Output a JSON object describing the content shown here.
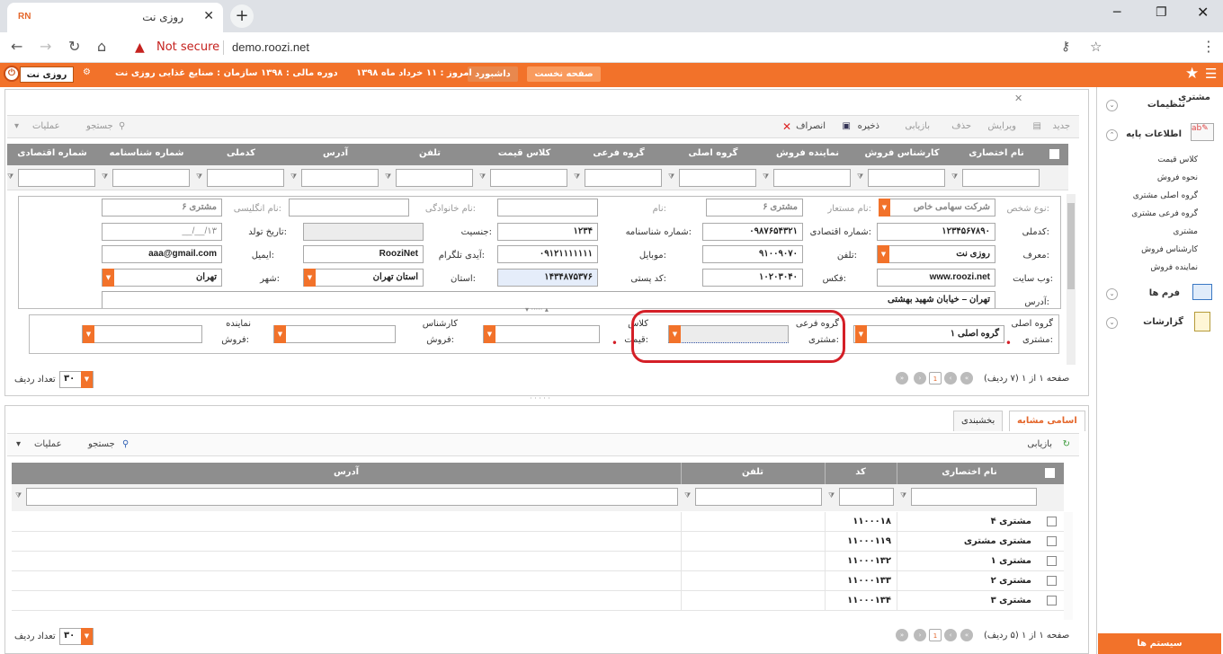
{
  "browser": {
    "tab_title": "روزی نت",
    "tab_icon_text": "RN",
    "new_tab": "+",
    "minimize": "─",
    "restore": "❐",
    "close": "✕",
    "not_secure": "Not secure",
    "url": "demo.roozi.net"
  },
  "topbar": {
    "home_btn": "صفحه نخست",
    "dashboard_btn": "داشبورد",
    "today": "امروز : ۱۱ خرداد ماه ۱۳۹۸",
    "fiscal": "دوره مالی : ۱۳۹۸",
    "org": "سازمان : صنایع غذایی روزی نت",
    "user": "روزی نت"
  },
  "sidebar": {
    "settings": "تنظیمات",
    "base_info": "اطلاعات پایه",
    "items": [
      "کلاس قیمت",
      "نحوه فروش",
      "گروه اصلی مشتری",
      "گروه فرعی مشتری",
      "مشتری",
      "کارشناس فروش",
      "نماینده فروش"
    ],
    "forms": "فرم ها",
    "reports": "گزارشات",
    "system": "سیستم ها"
  },
  "panel": {
    "tab": "مشتری",
    "toolbar": {
      "new": "جدید",
      "edit": "ویرایش",
      "delete": "حذف",
      "refresh": "بازیابی",
      "save": "ذخیره",
      "cancel": "انصراف",
      "search": "جستجو",
      "ops": "عملیات"
    },
    "columns": [
      "نام اختصاری",
      "کارشناس فروش",
      "نماینده فروش",
      "گروه اصلی",
      "گروه فرعی",
      "کلاس قیمت",
      "تلفن",
      "آدرس",
      "کدملی",
      "شماره شناسنامه",
      "شماره اقتصادی"
    ]
  },
  "form": {
    "row0": {
      "l1": "نوع شخص:",
      "v1": "شرکت سهامی خاص",
      "l2": "نام مستعار:",
      "v2": "مشتری ۶",
      "l3": "نام:",
      "l4": "نام خانوادگی:",
      "l5": "نام انگلیسی:",
      "v5": "مشتری ۶"
    },
    "row1": {
      "l1": "کدملی:",
      "v1": "۱۲۳۴۵۶۷۸۹۰",
      "l2": "شماره اقتصادی:",
      "v2": "۰۹۸۷۶۵۴۳۲۱",
      "l3": "شماره شناسنامه:",
      "v3": "۱۲۳۴",
      "l4": "جنسیت:",
      "l5": "تاریخ تولد:",
      "v5": "__/__/۱۳"
    },
    "row2": {
      "l1": "معرف:",
      "v1": "روزی نت",
      "l2": "تلفن:",
      "v2": "۹۱۰۰۹۰۷۰",
      "l3": "موبایل:",
      "v3": "۰۹۱۲۱۱۱۱۱۱۱",
      "l4": "آیدی تلگرام:",
      "v4": "RooziNet",
      "l5": "ایمیل:",
      "v5": "aaa@gmail.com"
    },
    "row3": {
      "l1": "وب سایت:",
      "v1": "www.roozi.net",
      "l2": "فکس:",
      "v2": "۱۰۲۰۳۰۴۰",
      "l3": "کد پستی:",
      "v3": "۱۴۳۴۸۷۵۳۷۶",
      "l4": "استان:",
      "v4": "استان تهران",
      "l5": "شهر:",
      "v5": "تهران"
    },
    "row4": {
      "l1": "آدرس:",
      "v1": "تهران – خیابان شهید بهشتی"
    },
    "group": {
      "main_l1": "گروه اصلی",
      "main_l2": "مشتری:",
      "main_v": "گروه اصلی ۱",
      "sub_l1": "گروه فرعی",
      "sub_l2": "مشتری:",
      "price_l1": "کلاس",
      "price_l2": "قیمت:",
      "expert_l1": "کارشناس",
      "expert_l2": "فروش:",
      "rep_l1": "نماینده",
      "rep_l2": "فروش:"
    },
    "required_mark": "•"
  },
  "pager1": {
    "text": "صفحه ۱ از ۱ (۷ ردیف)",
    "page": "1",
    "rows": "۳۰",
    "rows_label": "تعداد ردیف"
  },
  "lower": {
    "tab_similar": "اسامی مشابه",
    "tab_segment": "بخشبندی",
    "refresh": "بازیابی",
    "search": "جستجو",
    "ops": "عملیات",
    "columns": [
      "نام اختصاری",
      "کد",
      "تلفن",
      "آدرس"
    ],
    "rows": [
      {
        "name": "مشتری ۴",
        "code": "۱۱۰۰۰۱۸"
      },
      {
        "name": "مشتری مشتری",
        "code": "۱۱۰۰۰۱۱۹"
      },
      {
        "name": "مشتری ۱",
        "code": "۱۱۰۰۰۱۳۲"
      },
      {
        "name": "مشتری ۲",
        "code": "۱۱۰۰۰۱۳۳"
      },
      {
        "name": "مشتری ۳",
        "code": "۱۱۰۰۰۱۳۴"
      }
    ]
  },
  "pager2": {
    "text": "صفحه ۱ از ۱ (۵ ردیف)",
    "page": "1",
    "rows": "۳۰",
    "rows_label": "تعداد ردیف"
  },
  "colors": {
    "accent": "#f2722a",
    "highlight": "#d41f27",
    "grid_header": "#8e8e8e"
  }
}
